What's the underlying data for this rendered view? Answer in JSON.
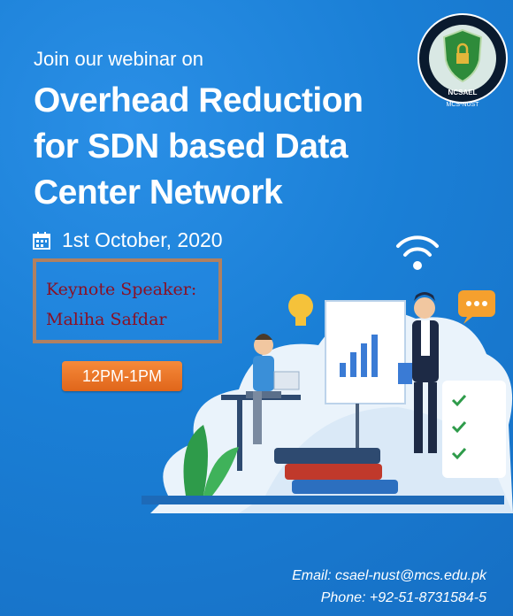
{
  "intro": "Join our webinar on",
  "title_lines": [
    "Overhead Reduction",
    "for SDN based Data",
    "Center Network"
  ],
  "date": "1st October, 2020",
  "speaker": {
    "line1": "Keynote Speaker:",
    "line2": "Maliha Safdar"
  },
  "time": "12PM-1PM",
  "contact": {
    "email": "Email: csael-nust@mcs.edu.pk",
    "phone": "Phone: +92-51-8731584-5"
  },
  "logo": {
    "name": "NCSAEL",
    "sub": "MCS-NUST",
    "ring": "NATIONAL CYBER SECURITY AUDITING & EVALUATION LAB"
  },
  "icons": [
    "calendar-icon",
    "wifi-icon",
    "lightbulb-icon",
    "chat-bubble-icon",
    "checklist-icon",
    "lock-icon"
  ],
  "colors": {
    "background": "#1a7fd6",
    "speaker_text": "#8a1024",
    "speaker_border": "#b08061",
    "time_button": "#f07a2a"
  }
}
